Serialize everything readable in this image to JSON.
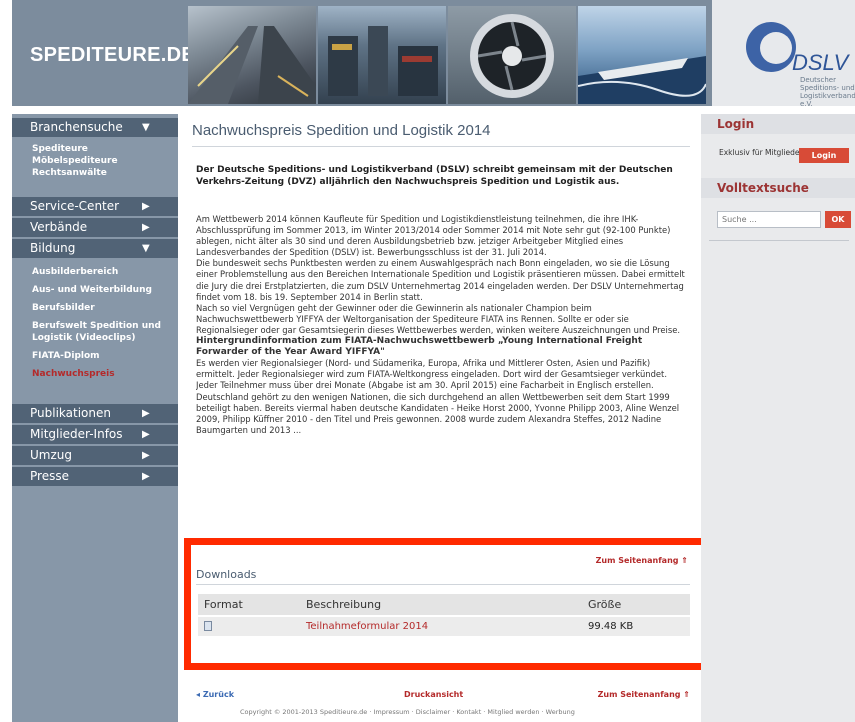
{
  "header": {
    "logo": "SPEDITEURE.DE",
    "dslv_logo": "DSLV",
    "dslv_sub": "Deutscher Speditions- und Logistikverband e.V."
  },
  "sidebar": {
    "branchensuche": {
      "label": "Branchensuche",
      "items": [
        "Spediteure",
        "Möbelspediteure",
        "Rechtsanwälte"
      ]
    },
    "service_center": "Service-Center",
    "verbaende": "Verbände",
    "bildung": {
      "label": "Bildung",
      "items": [
        "Ausbilderbereich",
        "Aus- und Weiterbildung",
        "Berufsbilder",
        "Berufswelt Spedition und Logistik (Videoclips)",
        "FIATA-Diplom",
        "Nachwuchspreis"
      ]
    },
    "publikationen": "Publikationen",
    "mitglieder_infos": "Mitglieder-Infos",
    "umzug": "Umzug",
    "presse": "Presse"
  },
  "main": {
    "title": "Nachwuchspreis Spedition und Logistik 2014",
    "intro": "Der Deutsche Speditions- und Logistikverband (DSLV) schreibt gemeinsam mit der Deutschen Verkehrs-Zeitung (DVZ) alljährlich den Nachwuchspreis Spedition und Logistik aus.",
    "paragraphs": [
      "Am Wettbewerb 2014 können Kaufleute für Spedition und Logistikdienstleistung teilnehmen, die ihre IHK-Abschlussprüfung im Sommer 2013, im Winter 2013/2014 oder Sommer 2014 mit Note sehr gut (92-100 Punkte) ablegen, nicht älter als 30 sind und deren Ausbildungsbetrieb bzw. jetziger Arbeitgeber Mitglied eines Landesverbandes der Spedition (DSLV) ist. Bewerbungsschluss ist der 31. Juli 2014.",
      "Die bundesweit sechs Punktbesten werden zu einem Auswahlgespräch nach Bonn eingeladen, wo sie die Lösung einer Problemstellung aus den Bereichen Internationale Spedition und Logistik präsentieren müssen. Dabei ermittelt die Jury die drei Erstplatzierten, die zum DSLV Unternehmertag 2014 eingeladen werden. Der DSLV Unternehmertag findet vom 18. bis 19. September 2014 in Berlin statt.",
      "Nach so viel Vergnügen geht der Gewinner oder die Gewinnerin als nationaler Champion beim Nachwuchswettbewerb YIFFYA der Weltorganisation der Spediteure FIATA ins Rennen. Sollte er oder sie Regionalsieger oder gar Gesamtsiegerin dieses Wettbewerbes werden, winken weitere Auszeichnungen und Preise."
    ],
    "sub_heading": "Hintergrundinformation zum FIATA-Nachwuchswettbewerb „Young International Freight Forwarder of the Year Award YIFFYA\"",
    "paragraph_last": "Es werden vier Regionalsieger (Nord- und Südamerika, Europa, Afrika und Mittlerer Osten, Asien und Pazifik) ermittelt. Jeder Regionalsieger wird zum FIATA-Weltkongress eingeladen. Dort wird der Gesamtsieger verkündet. Jeder Teilnehmer muss über drei Monate (Abgabe ist am 30. April 2015) eine Facharbeit in Englisch erstellen. Deutschland gehört zu den wenigen Nationen, die sich durchgehend an allen Wettbewerben seit dem Start 1999 beteiligt haben. Bereits viermal haben deutsche Kandidaten - Heike Horst 2000, Yvonne Philipp 2003, Aline Wenzel 2009, Philipp Küffner 2010 - den Titel und Preis gewonnen. 2008 wurde zudem Alexandra Steffes, 2012 Nadine Baumgarten und 2013 ..."
  },
  "downloads": {
    "top_link": "Zum Seitenanfang",
    "title": "Downloads",
    "columns": [
      "Format",
      "Beschreibung",
      "Größe"
    ],
    "rows": [
      {
        "format_icon": "document-icon",
        "description": "Teilnahmeformular 2014",
        "size": "99.48 KB"
      }
    ]
  },
  "bottom": {
    "back": "Zurück",
    "print": "Druckansicht",
    "top": "Zum Seitenanfang",
    "copyright": "Copyright © 2001-2013 Speditieure.de · Impressum · Disclaimer · Kontakt · Mitglied werden · Werbung"
  },
  "right": {
    "login_title": "Login",
    "login_info": "Exklusiv für Mitglieder",
    "login_button": "Login",
    "search_title": "Volltextsuche",
    "search_placeholder": "Suche ...",
    "search_button": "OK"
  },
  "colors": {
    "accent_red": "#d84b37",
    "frame_red": "#ff2a00",
    "nav_bg": "#8797a8",
    "nav_head": "#516376"
  }
}
